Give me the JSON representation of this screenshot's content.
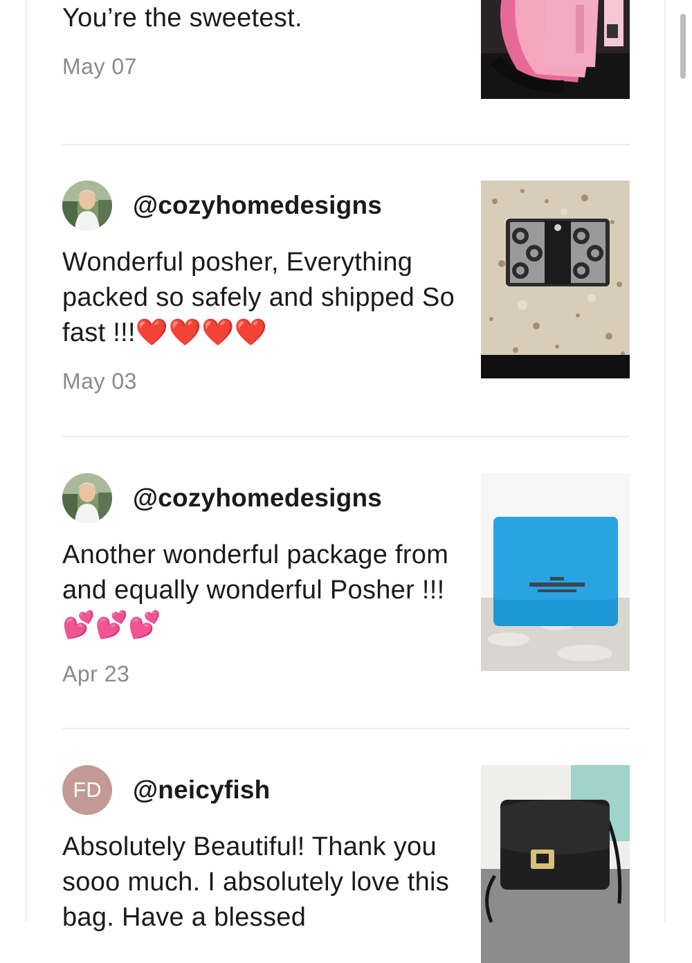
{
  "reviews": [
    {
      "comment": "You’re the sweetest.",
      "date": "May 07",
      "thumbnail_icon": "pink-bags-photo"
    },
    {
      "username": "@cozyhomedesigns",
      "avatar_icon": "user-photo-avatar",
      "comment": "Wonderful posher, Everything packed so safely and shipped So fast !!!❤️❤️❤️❤️",
      "date": "May 03",
      "thumbnail_icon": "signature-wallet-photo"
    },
    {
      "username": "@cozyhomedesigns",
      "avatar_icon": "user-photo-avatar",
      "comment": "Another wonderful package from and equally wonderful Posher !!!💕💕💕",
      "date": "Apr 23",
      "thumbnail_icon": "blue-wallet-photo"
    },
    {
      "username": "@neicyfish",
      "avatar_initials": "FD",
      "comment": "Absolutely Beautiful! Thank you sooo much. I absolutely love this bag. Have a blessed",
      "thumbnail_icon": "black-crossbody-bag-photo"
    }
  ],
  "colors": {
    "divider": "#ececec",
    "date_text": "#8a8a8a",
    "initials_avatar_bg": "#c49a94",
    "heart_red": "#e0161e",
    "heart_pink": "#f03ca0"
  }
}
